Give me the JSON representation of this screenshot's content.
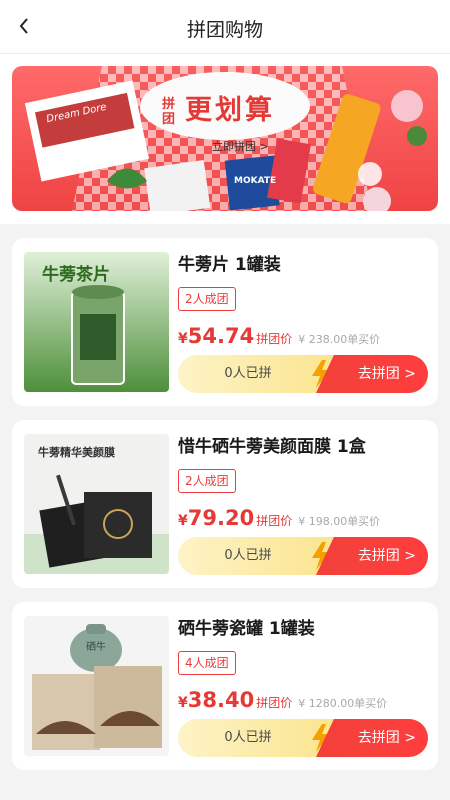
{
  "nav": {
    "title": "拼团购物"
  },
  "banner": {
    "small_text": "拼团",
    "headline": "更划算",
    "cta": "立即拼团 >",
    "box_text": "Dream Dore",
    "mokate": "MOKATE",
    "colors": {
      "bg": "#ef4343",
      "headline": "#e53935"
    }
  },
  "products": [
    {
      "name": "牛蒡片 1罐装",
      "badge": "2人成团",
      "currency": "¥",
      "price": "54.74",
      "price_tag": "拼团价",
      "original": "¥ 238.00单买价",
      "joined": "0人已拼",
      "action": "去拼团 >",
      "thumb_text": "牛蒡茶片"
    },
    {
      "name": "惜牛硒牛蒡美颜面膜 1盒",
      "badge": "2人成团",
      "currency": "¥",
      "price": "79.20",
      "price_tag": "拼团价",
      "original": "¥ 198.00单买价",
      "joined": "0人已拼",
      "action": "去拼团 >",
      "thumb_text": "牛蒡精华美颜膜"
    },
    {
      "name": "硒牛蒡瓷罐 1罐装",
      "badge": "4人成团",
      "currency": "¥",
      "price": "38.40",
      "price_tag": "拼团价",
      "original": "¥ 1280.00单买价",
      "joined": "0人已拼",
      "action": "去拼团 >",
      "thumb_text": "硒牛"
    }
  ],
  "icons": {
    "back": "chevron-left-icon",
    "bolt": "lightning-icon"
  }
}
